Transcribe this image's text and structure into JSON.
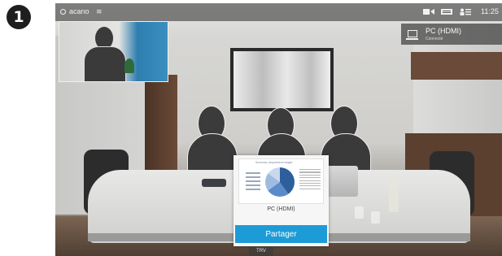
{
  "step": {
    "number": "1"
  },
  "status_bar": {
    "system_name": "acano",
    "wifi_icon": "wifi-icon",
    "clock": "11:25",
    "icons": [
      "camera-icon",
      "keyboard-icon",
      "participants-icon"
    ]
  },
  "share_source": {
    "name": "PC (HDMI)",
    "status": "Connecté"
  },
  "preview": {
    "label": "PC (HDMI)",
    "share_button": "Partager",
    "slide_title": "Summary department budget"
  },
  "page_tag": "TRV",
  "colors": {
    "accent": "#1d9bd7",
    "status_bar": "#282828",
    "source_panel": "#464646"
  }
}
